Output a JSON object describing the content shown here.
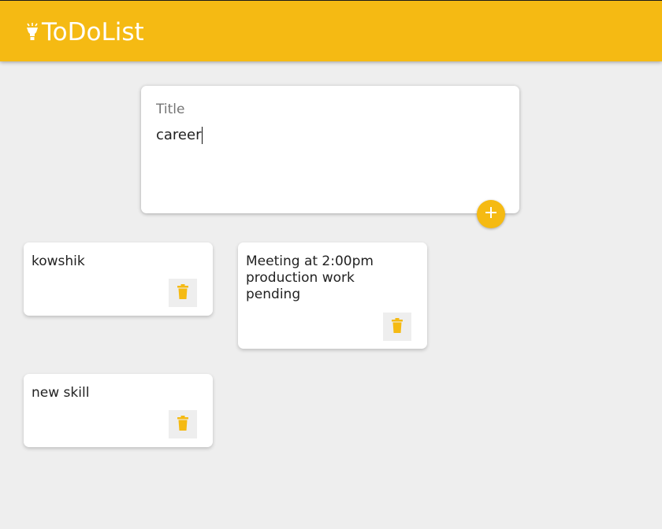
{
  "app": {
    "title": "ToDoList"
  },
  "form": {
    "title_placeholder": "Title",
    "content_value": "career",
    "add_icon": "plus-icon"
  },
  "notes": [
    {
      "text": "kowshik",
      "delete_icon": "trash-icon"
    },
    {
      "text": "Meeting at 2:00pm production work pending",
      "delete_icon": "trash-icon"
    },
    {
      "text": "new skill",
      "delete_icon": "trash-icon"
    }
  ],
  "colors": {
    "accent": "#f5ba13",
    "background": "#eeeeee",
    "card": "#ffffff"
  }
}
